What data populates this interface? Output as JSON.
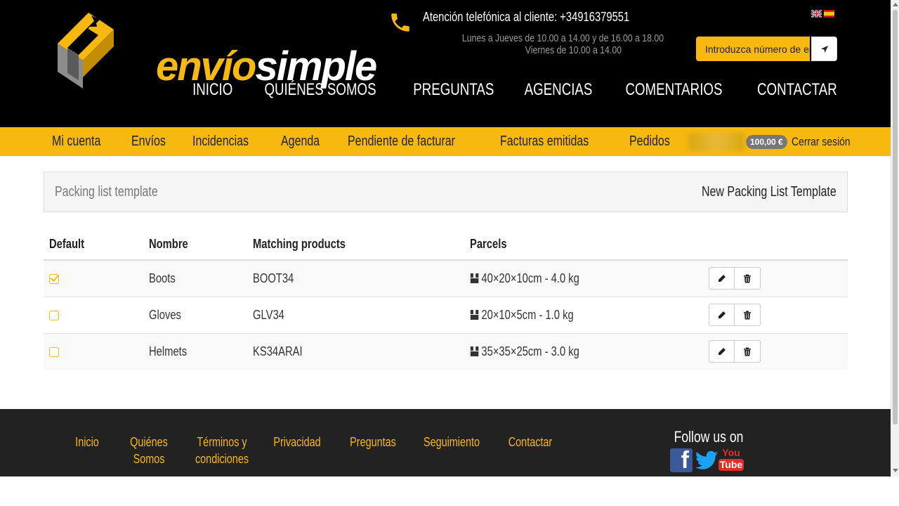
{
  "brand": {
    "logo_part1": "envío",
    "logo_part2": "simple",
    "accent": "#f7b80f"
  },
  "contact": {
    "phone_line": "Atención telefónica al cliente: +34916379551",
    "hours_line1": "Lunes a Jueves de 10.00 a 14.00 y de 16.00 a 18.00",
    "hours_line2": "Viernes de 10.00 a 14.00"
  },
  "tracking": {
    "placeholder": "Introduzca número de envío"
  },
  "main_nav": [
    "INICIO",
    "QUIÉNES SOMOS",
    "PREGUNTAS",
    "AGENCIAS",
    "COMENTARIOS",
    "CONTACTAR"
  ],
  "sub_nav": [
    "Mi cuenta",
    "Envíos",
    "Incidencias",
    "Agenda",
    "Pendiente de facturar",
    "Facturas emitidas",
    "Pedidos"
  ],
  "user": {
    "balance": "100,00 €",
    "logout": "Cerrar sesión"
  },
  "panel": {
    "title": "Packing list template",
    "action": "New Packing List Template"
  },
  "table": {
    "headers": [
      "Default",
      "Nombre",
      "Matching products",
      "Parcels"
    ],
    "rows": [
      {
        "default": true,
        "name": "Boots",
        "matching": "BOOT34",
        "parcels": "40×20×10cm - 4.0 kg"
      },
      {
        "default": false,
        "name": "Gloves",
        "matching": "GLV34",
        "parcels": "20×10×5cm - 1.0 kg"
      },
      {
        "default": false,
        "name": "Helmets",
        "matching": "KS34ARAI",
        "parcels": "35×35×25cm - 3.0 kg"
      }
    ]
  },
  "footer": {
    "links": [
      {
        "line1": "Inicio",
        "line2": ""
      },
      {
        "line1": "Quiénes",
        "line2": "Somos"
      },
      {
        "line1": "Términos y",
        "line2": "condiciones"
      },
      {
        "line1": "Privacidad",
        "line2": ""
      },
      {
        "line1": "Preguntas",
        "line2": ""
      },
      {
        "line1": "Seguimiento",
        "line2": ""
      },
      {
        "line1": "Contactar",
        "line2": ""
      }
    ],
    "follow": "Follow us on",
    "youtube_you": "You",
    "youtube_tube": "Tube"
  }
}
